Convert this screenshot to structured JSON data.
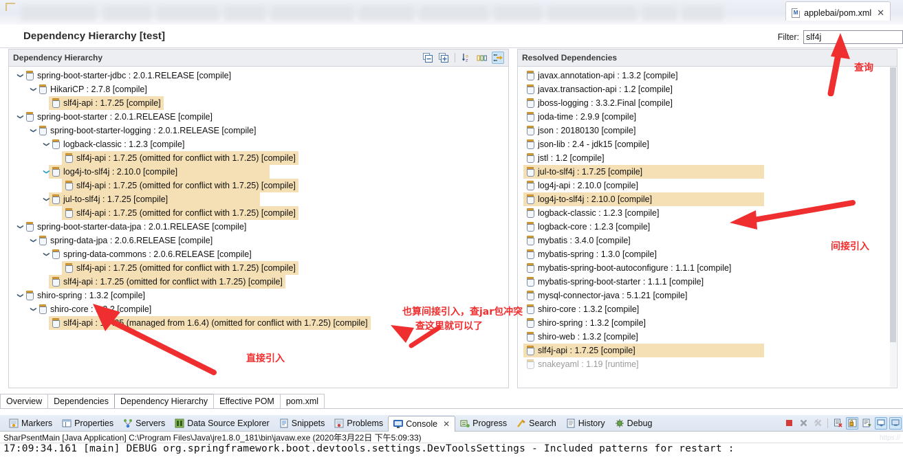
{
  "window": {
    "editor_tab": {
      "label": "applebai/pom.xml",
      "icon": "maven-file-icon",
      "close": "✕"
    }
  },
  "header": {
    "title": "Dependency Hierarchy [test]"
  },
  "filter": {
    "label": "Filter:",
    "value": "slf4j",
    "placeholder": ""
  },
  "left_panel": {
    "title": "Dependency Hierarchy",
    "tools": [
      {
        "name": "collapse-all-icon",
        "title": "Collapse All"
      },
      {
        "name": "expand-all-icon",
        "title": "Expand All"
      },
      {
        "name": "sort-alphabetically-icon",
        "title": "Sort"
      },
      {
        "name": "show-groupid-icon",
        "title": "Show GroupId"
      },
      {
        "name": "layout-toggle-icon",
        "title": "Layout"
      }
    ],
    "rows": [
      {
        "indent": 0,
        "twisty": "down",
        "label": "spring-boot-starter-jdbc : 2.0.1.RELEASE [compile]",
        "hl": 0
      },
      {
        "indent": 1,
        "twisty": "down",
        "label": "HikariCP : 2.7.8 [compile]",
        "hl": 0
      },
      {
        "indent": 2,
        "twisty": "none",
        "label": "slf4j-api : 1.7.25 [compile]",
        "hl": 1
      },
      {
        "indent": 0,
        "twisty": "down",
        "label": "spring-boot-starter : 2.0.1.RELEASE [compile]",
        "hl": 0
      },
      {
        "indent": 1,
        "twisty": "down",
        "label": "spring-boot-starter-logging : 2.0.1.RELEASE [compile]",
        "hl": 0
      },
      {
        "indent": 2,
        "twisty": "down",
        "label": "logback-classic : 1.2.3 [compile]",
        "hl": 0
      },
      {
        "indent": 3,
        "twisty": "none",
        "label": "slf4j-api : 1.7.25 (omitted for conflict with 1.7.25) [compile]",
        "hl": 1
      },
      {
        "indent": 2,
        "twisty": "down-teal",
        "label": "log4j-to-slf4j : 2.10.0 [compile]",
        "hl": 2
      },
      {
        "indent": 3,
        "twisty": "none",
        "label": "slf4j-api : 1.7.25 (omitted for conflict with 1.7.25) [compile]",
        "hl": 1
      },
      {
        "indent": 2,
        "twisty": "down",
        "label": "jul-to-slf4j : 1.7.25 [compile]",
        "hl": 2
      },
      {
        "indent": 3,
        "twisty": "none",
        "label": "slf4j-api : 1.7.25 (omitted for conflict with 1.7.25) [compile]",
        "hl": 1
      },
      {
        "indent": 0,
        "twisty": "down",
        "label": "spring-boot-starter-data-jpa : 2.0.1.RELEASE [compile]",
        "hl": 0
      },
      {
        "indent": 1,
        "twisty": "down",
        "label": "spring-data-jpa : 2.0.6.RELEASE [compile]",
        "hl": 0
      },
      {
        "indent": 2,
        "twisty": "down",
        "label": "spring-data-commons : 2.0.6.RELEASE [compile]",
        "hl": 0
      },
      {
        "indent": 3,
        "twisty": "none",
        "label": "slf4j-api : 1.7.25 (omitted for conflict with 1.7.25) [compile]",
        "hl": 1
      },
      {
        "indent": 2,
        "twisty": "none",
        "label": "slf4j-api : 1.7.25 (omitted for conflict with 1.7.25) [compile]",
        "hl": 1
      },
      {
        "indent": 0,
        "twisty": "down",
        "label": "shiro-spring : 1.3.2 [compile]",
        "hl": 0
      },
      {
        "indent": 1,
        "twisty": "down",
        "label": "shiro-core : 1.3.2 [compile]",
        "hl": 0
      },
      {
        "indent": 2,
        "twisty": "none",
        "label": "slf4j-api : 1.7.25 (managed from 1.6.4) (omitted for conflict with 1.7.25) [compile]",
        "hl": 1
      }
    ]
  },
  "right_panel": {
    "title": "Resolved Dependencies",
    "rows": [
      {
        "label": "javax.annotation-api : 1.3.2 [compile]",
        "hl": 0,
        "dim": 0
      },
      {
        "label": "javax.transaction-api : 1.2 [compile]",
        "hl": 0,
        "dim": 0
      },
      {
        "label": "jboss-logging : 3.3.2.Final [compile]",
        "hl": 0,
        "dim": 0
      },
      {
        "label": "joda-time : 2.9.9 [compile]",
        "hl": 0,
        "dim": 0
      },
      {
        "label": "json : 20180130 [compile]",
        "hl": 0,
        "dim": 0
      },
      {
        "label": "json-lib : 2.4 - jdk15 [compile]",
        "hl": 0,
        "dim": 0
      },
      {
        "label": "jstl : 1.2 [compile]",
        "hl": 0,
        "dim": 0
      },
      {
        "label": "jul-to-slf4j : 1.7.25 [compile]",
        "hl": 1,
        "dim": 0
      },
      {
        "label": "log4j-api : 2.10.0 [compile]",
        "hl": 0,
        "dim": 0
      },
      {
        "label": "log4j-to-slf4j : 2.10.0 [compile]",
        "hl": 1,
        "dim": 0
      },
      {
        "label": "logback-classic : 1.2.3 [compile]",
        "hl": 0,
        "dim": 0
      },
      {
        "label": "logback-core : 1.2.3 [compile]",
        "hl": 0,
        "dim": 0
      },
      {
        "label": "mybatis : 3.4.0 [compile]",
        "hl": 0,
        "dim": 0
      },
      {
        "label": "mybatis-spring : 1.3.0 [compile]",
        "hl": 0,
        "dim": 0
      },
      {
        "label": "mybatis-spring-boot-autoconfigure : 1.1.1 [compile]",
        "hl": 0,
        "dim": 0
      },
      {
        "label": "mybatis-spring-boot-starter : 1.1.1 [compile]",
        "hl": 0,
        "dim": 0
      },
      {
        "label": "mysql-connector-java : 5.1.21 [compile]",
        "hl": 0,
        "dim": 0
      },
      {
        "label": "shiro-core : 1.3.2 [compile]",
        "hl": 0,
        "dim": 0
      },
      {
        "label": "shiro-spring : 1.3.2 [compile]",
        "hl": 0,
        "dim": 0
      },
      {
        "label": "shiro-web : 1.3.2 [compile]",
        "hl": 0,
        "dim": 0
      },
      {
        "label": "slf4j-api : 1.7.25 [compile]",
        "hl": 1,
        "dim": 0
      },
      {
        "label": "snakeyaml : 1.19 [runtime]",
        "hl": 0,
        "dim": 1
      }
    ]
  },
  "editor_tabs": [
    {
      "label": "Overview",
      "selected": false
    },
    {
      "label": "Dependencies",
      "selected": false
    },
    {
      "label": "Dependency Hierarchy",
      "selected": true
    },
    {
      "label": "Effective POM",
      "selected": false
    },
    {
      "label": "pom.xml",
      "selected": false
    }
  ],
  "view_tabs": [
    {
      "label": "Markers",
      "icon": "markers-icon",
      "selected": false
    },
    {
      "label": "Properties",
      "icon": "properties-icon",
      "selected": false
    },
    {
      "label": "Servers",
      "icon": "servers-icon",
      "selected": false
    },
    {
      "label": "Data Source Explorer",
      "icon": "data-source-explorer-icon",
      "selected": false
    },
    {
      "label": "Snippets",
      "icon": "snippets-icon",
      "selected": false
    },
    {
      "label": "Problems",
      "icon": "problems-icon",
      "selected": false
    },
    {
      "label": "Console",
      "icon": "console-icon",
      "selected": true,
      "close": "✕"
    },
    {
      "label": "Progress",
      "icon": "progress-icon",
      "selected": false
    },
    {
      "label": "Search",
      "icon": "search-icon",
      "selected": false
    },
    {
      "label": "History",
      "icon": "history-icon",
      "selected": false
    },
    {
      "label": "Debug",
      "icon": "debug-icon",
      "selected": false
    }
  ],
  "console_tools": [
    {
      "name": "terminate-icon",
      "on": false
    },
    {
      "name": "remove-launch-icon",
      "on": false
    },
    {
      "name": "remove-all-terminated-icon",
      "on": false
    },
    {
      "name": "clear-console-icon",
      "on": false
    },
    {
      "name": "scroll-lock-icon",
      "on": true
    },
    {
      "name": "word-wrap-icon",
      "on": false
    },
    {
      "name": "pin-console-icon",
      "on": true
    },
    {
      "name": "display-selected-console-icon",
      "on": true
    }
  ],
  "console": {
    "launch_header": "SharPsentMain [Java Application] C:\\Program Files\\Java\\jre1.8.0_181\\bin\\javaw.exe (2020年3月22日 下午5:09:33)",
    "line1": "17:09:34.161 [main] DEBUG org.springframework.boot.devtools.settings.DevToolsSettings - Included patterns for restart :"
  },
  "annotations": [
    {
      "name": "annotation-query",
      "text": "查询"
    },
    {
      "name": "annotation-indirect-import",
      "text": "间接引入"
    },
    {
      "name": "annotation-also-indirect-line1",
      "text": "也算间接引入，查jar包冲突"
    },
    {
      "name": "annotation-also-indirect-line2",
      "text": "查这里就可以了"
    },
    {
      "name": "annotation-direct-import",
      "text": "直接引入"
    }
  ],
  "colors": {
    "highlight": "#f5dfb5",
    "annotation_red": "#ef2f2f",
    "tab_selected": "#cfe5f8"
  }
}
